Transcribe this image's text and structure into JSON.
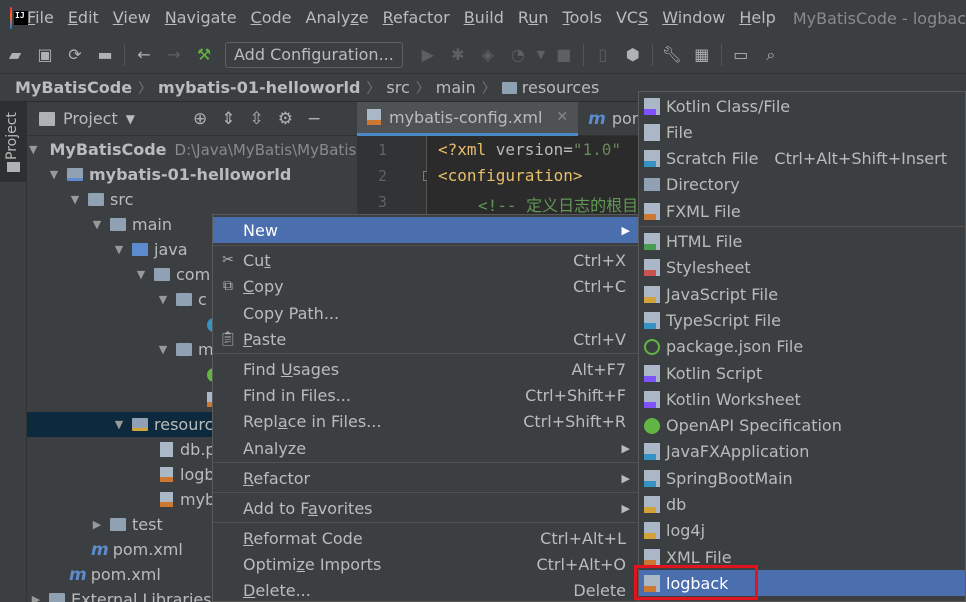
{
  "menubar": {
    "items": [
      {
        "pre": "",
        "u": "F",
        "post": "ile"
      },
      {
        "pre": "",
        "u": "E",
        "post": "dit"
      },
      {
        "pre": "",
        "u": "V",
        "post": "iew"
      },
      {
        "pre": "",
        "u": "N",
        "post": "avigate"
      },
      {
        "pre": "",
        "u": "C",
        "post": "ode"
      },
      {
        "pre": "Analy",
        "u": "z",
        "post": "e"
      },
      {
        "pre": "",
        "u": "R",
        "post": "efactor"
      },
      {
        "pre": "",
        "u": "B",
        "post": "uild"
      },
      {
        "pre": "R",
        "u": "u",
        "post": "n"
      },
      {
        "pre": "",
        "u": "T",
        "post": "ools"
      },
      {
        "pre": "VC",
        "u": "S",
        "post": ""
      },
      {
        "pre": "",
        "u": "W",
        "post": "indow"
      },
      {
        "pre": "",
        "u": "H",
        "post": "elp"
      }
    ],
    "window_title": "MyBatisCode - logbac"
  },
  "toolbar": {
    "add_config": "Add Configuration..."
  },
  "breadcrumb": [
    "MyBatisCode",
    "mybatis-01-helloworld",
    "src",
    "main",
    "resources"
  ],
  "stripe": {
    "project_label": "Project"
  },
  "project_panel": {
    "title": "Project"
  },
  "tree": {
    "root": "MyBatisCode",
    "root_path": "D:\\Java\\MyBatis\\MyBatisC",
    "module": "mybatis-01-helloworld",
    "src": "src",
    "main": "main",
    "java": "java",
    "com": "com",
    "pkg1": "c",
    "pkg2": "m",
    "resources": "resourc",
    "db": "db.p",
    "logb": "logb",
    "myb": "myb",
    "test": "test",
    "pom_module": "pom.xml",
    "pom_root": "pom.xml",
    "ext": "External Libraries"
  },
  "editor": {
    "tabs": [
      "mybatis-config.xml",
      "pom.xm"
    ],
    "line_numbers": [
      "1",
      "2",
      "3"
    ],
    "lines": {
      "l1_open": "<?xml ",
      "l1_attr": "version=",
      "l1_str": "\"1.0\"",
      "l2": "<configuration>",
      "l3": "<!-- 定义日志的根目"
    }
  },
  "context_menu": {
    "new": "New",
    "cut": {
      "u": "t",
      "pre": "Cu",
      "post": "",
      "shortcut": "Ctrl+X"
    },
    "copy": {
      "u": "C",
      "pre": "",
      "post": "opy",
      "shortcut": "Ctrl+C"
    },
    "copy_path": "Copy Path...",
    "paste": {
      "u": "P",
      "pre": "",
      "post": "aste",
      "shortcut": "Ctrl+V"
    },
    "find_usages": {
      "pre": "Find ",
      "u": "U",
      "post": "sages",
      "shortcut": "Alt+F7"
    },
    "find_in_files": {
      "label": "Find in Files...",
      "shortcut": "Ctrl+Shift+F"
    },
    "replace_in_files": {
      "pre": "Repl",
      "u": "a",
      "post": "ce in Files...",
      "shortcut": "Ctrl+Shift+R"
    },
    "analyze": "Analyze",
    "refactor": {
      "pre": "",
      "u": "R",
      "post": "efactor"
    },
    "add_to_favorites": {
      "pre": "Add to F",
      "u": "a",
      "post": "vorites"
    },
    "reformat": {
      "pre": "",
      "u": "R",
      "post": "eformat Code",
      "shortcut": "Ctrl+Alt+L"
    },
    "optimize": {
      "pre": "Optimi",
      "u": "z",
      "post": "e Imports",
      "shortcut": "Ctrl+Alt+O"
    },
    "delete": {
      "pre": "",
      "u": "D",
      "post": "elete...",
      "shortcut": "Delete"
    }
  },
  "submenu": {
    "items": [
      {
        "label": "Kotlin Class/File",
        "shortcut": "",
        "icon": "kt"
      },
      {
        "label": "File",
        "shortcut": "",
        "icon": "plain"
      },
      {
        "label": "Scratch File",
        "shortcut": "Ctrl+Alt+Shift+Insert",
        "icon": "scratch"
      },
      {
        "label": "Directory",
        "shortcut": "",
        "icon": "dir"
      },
      {
        "label": "FXML File",
        "shortcut": "",
        "icon": "xml"
      },
      {
        "label": "HTML File",
        "shortcut": "",
        "icon": "html"
      },
      {
        "label": "Stylesheet",
        "shortcut": "",
        "icon": "css"
      },
      {
        "label": "JavaScript File",
        "shortcut": "",
        "icon": "js"
      },
      {
        "label": "TypeScript File",
        "shortcut": "",
        "icon": "ts"
      },
      {
        "label": "package.json File",
        "shortcut": "",
        "icon": "json"
      },
      {
        "label": "Kotlin Script",
        "shortcut": "",
        "icon": "kt"
      },
      {
        "label": "Kotlin Worksheet",
        "shortcut": "",
        "icon": "kt"
      },
      {
        "label": "OpenAPI Specification",
        "shortcut": "",
        "icon": "api"
      },
      {
        "label": "JavaFXApplication",
        "shortcut": "",
        "icon": "java"
      },
      {
        "label": "SpringBootMain",
        "shortcut": "",
        "icon": "java"
      },
      {
        "label": "db",
        "shortcut": "",
        "icon": "db"
      },
      {
        "label": "log4j",
        "shortcut": "",
        "icon": "db"
      },
      {
        "label": "XML File",
        "shortcut": "",
        "icon": "xml"
      },
      {
        "label": "logback",
        "shortcut": "",
        "icon": "xml"
      }
    ],
    "active_index": 18
  },
  "colors": {
    "accent": "#4b6eaf",
    "highlight": "#e0141e",
    "selection": "#0d293e"
  }
}
